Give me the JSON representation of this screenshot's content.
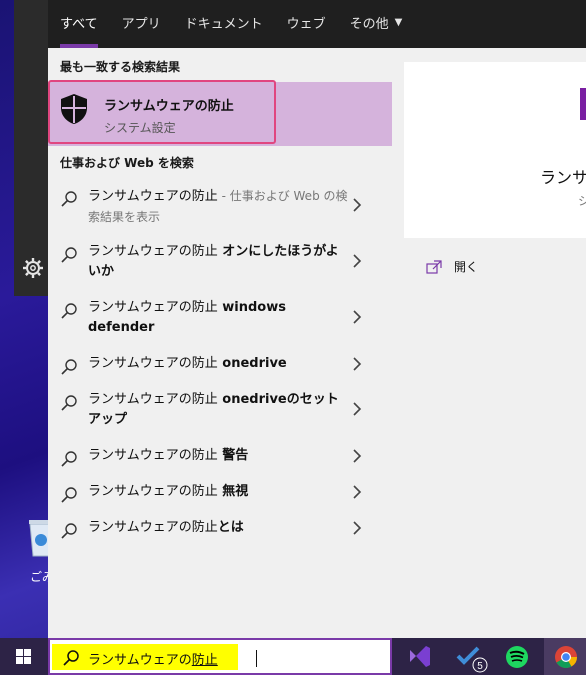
{
  "tabs": [
    {
      "label": "すべて",
      "active": true
    },
    {
      "label": "アプリ"
    },
    {
      "label": "ドキュメント"
    },
    {
      "label": "ウェブ"
    },
    {
      "label": "その他"
    }
  ],
  "best_match": {
    "heading": "最も一致する検索結果",
    "title": "ランサムウェアの防止",
    "subtitle": "システム設定",
    "icon": "shield-icon"
  },
  "web_section": {
    "heading": "仕事および Web を検索",
    "items": [
      {
        "query": "ランサムウェアの防止",
        "suffix": "",
        "note": " - 仕事および Web の検索結果を表示"
      },
      {
        "query": "ランサムウェアの防止",
        "suffix": " オンにしたほうがよいか",
        "note": ""
      },
      {
        "query": "ランサムウェアの防止",
        "suffix": " windows defender",
        "note": ""
      },
      {
        "query": "ランサムウェアの防止",
        "suffix": " onedrive",
        "note": ""
      },
      {
        "query": "ランサムウェアの防止",
        "suffix": " onedriveのセットアップ",
        "note": ""
      },
      {
        "query": "ランサムウェアの防止",
        "suffix": " 警告",
        "note": ""
      },
      {
        "query": "ランサムウェアの防止",
        "suffix": " 無視",
        "note": ""
      },
      {
        "query": "ランサムウェアの防止",
        "suffix": "とは",
        "note": ""
      }
    ]
  },
  "preview": {
    "title": "ランサム",
    "subtitle": "シ",
    "open_label": "開く"
  },
  "search": {
    "text_plain": "ランサムウェアの",
    "text_underlined": "防止"
  },
  "desktop": {
    "recycle_label": "ごみ"
  },
  "taskbar": {
    "todo_badge": "5"
  },
  "colors": {
    "accent": "#7a3aa8",
    "best_bg": "#d5b3dc",
    "focus_border": "#e04680",
    "search_highlight": "#ffff00"
  }
}
